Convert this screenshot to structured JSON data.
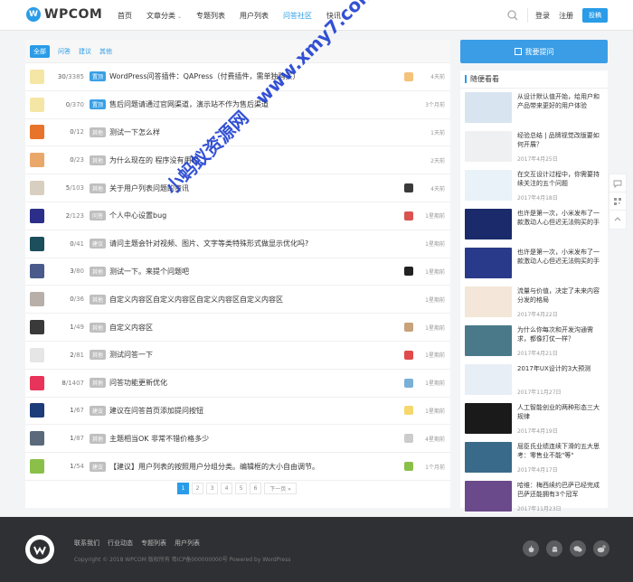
{
  "header": {
    "logo_text": "WPCOM",
    "nav": [
      {
        "label": "首页",
        "active": false,
        "caret": false
      },
      {
        "label": "文章分类",
        "active": false,
        "caret": true
      },
      {
        "label": "专题列表",
        "active": false,
        "caret": false
      },
      {
        "label": "用户列表",
        "active": false,
        "caret": false
      },
      {
        "label": "问答社区",
        "active": true,
        "caret": false
      },
      {
        "label": "快讯",
        "active": false,
        "caret": false
      }
    ],
    "login": "登录",
    "register": "注册",
    "submit": "投稿"
  },
  "tabs": [
    "全部",
    "问答",
    "建议",
    "其他"
  ],
  "rows": [
    {
      "count": "30",
      "total": "/3385",
      "tag": "置顶",
      "pin": true,
      "title": "WordPress问答插件：QAPress（付费插件，需单独购买）",
      "time": "4天前",
      "avatar_color": "#f5e6a6",
      "mini_color": "#f4c27a"
    },
    {
      "count": "0",
      "total": "/370",
      "tag": "置顶",
      "pin": true,
      "title": "售后问题请通过官网渠道，演示站不作为售后渠道",
      "time": "3个月前",
      "avatar_color": "#f5e6a6",
      "mini_color": ""
    },
    {
      "count": "0",
      "total": "/12",
      "tag": "其他",
      "pin": false,
      "title": "测试一下怎么样",
      "time": "1天前",
      "avatar_color": "#e8742b",
      "mini_color": ""
    },
    {
      "count": "0",
      "total": "/23",
      "tag": "其他",
      "pin": false,
      "title": "为什么现在的 程序没有用呢",
      "time": "2天前",
      "avatar_color": "#e9a86a",
      "mini_color": ""
    },
    {
      "count": "5",
      "total": "/103",
      "tag": "其他",
      "pin": false,
      "title": "关于用户列表问题的资讯",
      "time": "4天前",
      "avatar_color": "#d9cfc0",
      "mini_color": "#3a3a3a"
    },
    {
      "count": "2",
      "total": "/123",
      "tag": "问答",
      "pin": false,
      "title": "个人中心设置bug",
      "time": "1星期前",
      "avatar_color": "#2c2f8a",
      "mini_color": "#d9534f"
    },
    {
      "count": "0",
      "total": "/41",
      "tag": "建议",
      "pin": false,
      "title": "请问主题会针对视频、图片、文字等类特殊形式做显示优化吗?",
      "time": "1星期前",
      "avatar_color": "#1c4e5c",
      "mini_color": ""
    },
    {
      "count": "3",
      "total": "/80",
      "tag": "其他",
      "pin": false,
      "title": "测试一下。来提个问题吧",
      "time": "1星期前",
      "avatar_color": "#4a5a8a",
      "mini_color": "#222"
    },
    {
      "count": "0",
      "total": "/36",
      "tag": "其他",
      "pin": false,
      "title": "自定义内容区自定义内容区自定义内容区自定义内容区",
      "time": "1星期前",
      "avatar_color": "#b8b0a8",
      "mini_color": ""
    },
    {
      "count": "1",
      "total": "/49",
      "tag": "其他",
      "pin": false,
      "title": "自定义内容区",
      "time": "1星期前",
      "avatar_color": "#3a3a3a",
      "mini_color": "#c7a27a"
    },
    {
      "count": "2",
      "total": "/81",
      "tag": "其他",
      "pin": false,
      "title": "测试问答一下",
      "time": "1星期前",
      "avatar_color": "#e6e6e6",
      "mini_color": "#e04a4a"
    },
    {
      "count": "8",
      "total": "/1407",
      "tag": "其他",
      "pin": false,
      "title": "问答功能更新优化",
      "time": "1星期前",
      "avatar_color": "#e8345a",
      "mini_color": "#7ab0d8"
    },
    {
      "count": "1",
      "total": "/67",
      "tag": "建议",
      "pin": false,
      "title": "建议在问答首页添加提问按钮",
      "time": "1星期前",
      "avatar_color": "#1c3c7a",
      "mini_color": "#f5d76e"
    },
    {
      "count": "1",
      "total": "/87",
      "tag": "其他",
      "pin": false,
      "title": "主题相当OK 非常不错价格多少",
      "time": "4星期前",
      "avatar_color": "#5a6a7a",
      "mini_color": "#cccccc"
    },
    {
      "count": "1",
      "total": "/54",
      "tag": "建议",
      "pin": false,
      "title": "【建议】用户列表的按照用户分组分类。编辑框的大小自由调节。",
      "time": "1个月前",
      "avatar_color": "#8ac04a",
      "mini_color": "#8ac04a"
    }
  ],
  "pagination": [
    "1",
    "2",
    "3",
    "4",
    "5",
    "6",
    "下一页 »"
  ],
  "sidebar": {
    "ask_label": "我要提问",
    "title": "随便看看",
    "items": [
      {
        "title": "从设计默认值开始，给用户和产品带来更好的用户体验",
        "date": "",
        "color": "#d8e4ef"
      },
      {
        "title": "经验总结 | 品牌视觉改版要如何开展？",
        "date": "2017年4月25日",
        "color": "#eef0f2"
      },
      {
        "title": "在交互设计过程中，你需要持续关注的五个问题",
        "date": "2017年4月18日",
        "color": "#e8f2f8"
      },
      {
        "title": "也许是第一次，小米发布了一款激动人心但迟无法购买的手机",
        "date": "",
        "color": "#1a2a6a"
      },
      {
        "title": "也许是第一次，小米发布了一款激动人心但迟无法购买的手机",
        "date": "",
        "color": "#2a3a8a"
      },
      {
        "title": "流量与价值，决定了未来内容分发的格局",
        "date": "2017年4月22日",
        "color": "#f4e6d8"
      },
      {
        "title": "为什么你每次和开发沟通需求，都像打仗一样？",
        "date": "2017年4月21日",
        "color": "#4a7a8a"
      },
      {
        "title": "2017年UX设计的3大预测",
        "date": "2017年11月27日",
        "color": "#e8eef6"
      },
      {
        "title": "人工智能创业的两种形态三大规律",
        "date": "2017年4月19日",
        "color": "#1a1a1a"
      },
      {
        "title": "屈臣氏业绩连续下滑的五大思考：零售业不能\"等\"",
        "date": "2017年4月17日",
        "color": "#3a6a8a"
      },
      {
        "title": "哈维：梅西续约巴萨已经完成 巴萨还能拥有3个冠军",
        "date": "2017年11月23日",
        "color": "#6a4a8a"
      }
    ]
  },
  "footer": {
    "links": [
      "联系我们",
      "行业动态",
      "专题列表",
      "用户列表"
    ],
    "copyright": "Copyright © 2018 WPCOM 版权所有 粤ICP备000000000号 Powered by WordPress"
  },
  "watermark": [
    "小蚂蚁资源网",
    "www.xmy7.com"
  ]
}
